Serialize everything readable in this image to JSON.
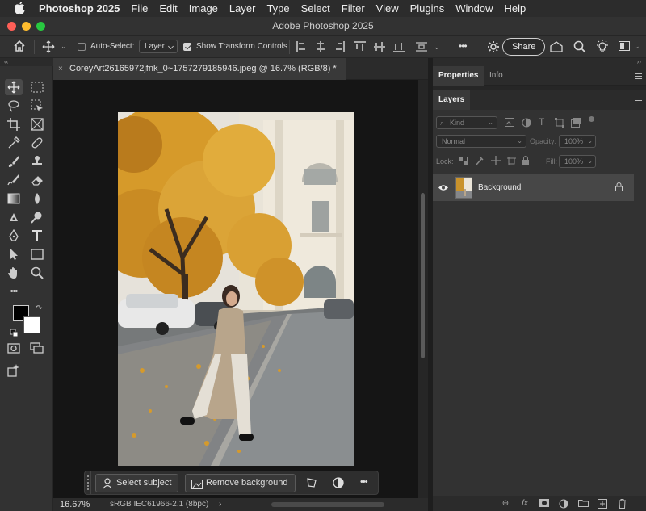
{
  "menubar": {
    "apple_icon": "apple-logo",
    "app_name": "Photoshop 2025",
    "items": [
      "File",
      "Edit",
      "Image",
      "Layer",
      "Type",
      "Select",
      "Filter",
      "View",
      "Plugins",
      "Window",
      "Help"
    ]
  },
  "window": {
    "title": "Adobe Photoshop 2025",
    "traffic_lights": [
      "#fe5f57",
      "#febc2e",
      "#28c840"
    ]
  },
  "options_bar": {
    "auto_select_label": "Auto-Select:",
    "auto_select_checked": false,
    "auto_select_target": "Layer",
    "show_transform_label": "Show Transform Controls",
    "show_transform_checked": true,
    "more_label": "•••",
    "share_label": "Share"
  },
  "document": {
    "tab_title": "CoreyArt26165972jfnk_0~1757279185946.jpeg @ 16.7% (RGB/8) *",
    "close_glyph": "×"
  },
  "taskbar": {
    "select_subject": "Select subject",
    "remove_background": "Remove background",
    "more": "•••"
  },
  "status": {
    "zoom": "16.67%",
    "profile": "sRGB IEC61966-2.1 (8bpc)",
    "arrow": "›"
  },
  "properties_panel": {
    "tabs": [
      "Properties",
      "Info"
    ],
    "active_tab": "Properties"
  },
  "layers_panel": {
    "title": "Layers",
    "filter_kind": "Kind",
    "blend_mode": "Normal",
    "opacity_label": "Opacity:",
    "opacity_value": "100%",
    "lock_label": "Lock:",
    "fill_label": "Fill:",
    "fill_value": "100%",
    "layers": [
      {
        "name": "Background",
        "visible": true,
        "locked": true
      }
    ]
  },
  "colors": {
    "foreground": "#000000",
    "background": "#ffffff",
    "accent_panel": "#323232"
  }
}
